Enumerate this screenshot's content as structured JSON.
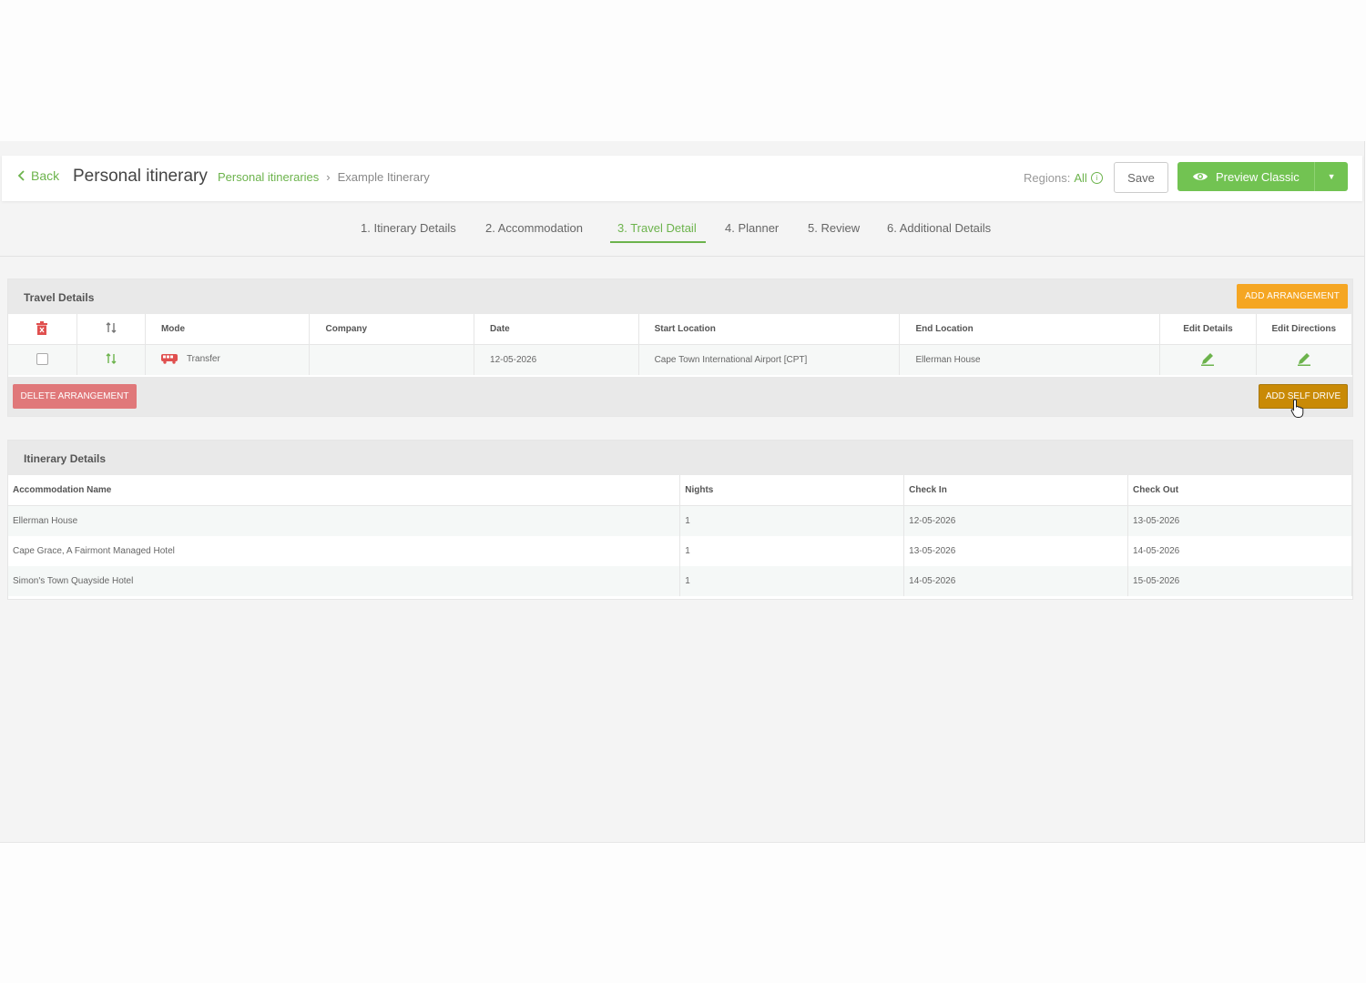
{
  "header": {
    "back_label": "Back",
    "title": "Personal itinerary",
    "breadcrumb": [
      {
        "label": "Personal itineraries"
      },
      {
        "label": "Example Itinerary"
      }
    ],
    "regions_label": "Regions:",
    "regions_value": "All",
    "save_label": "Save",
    "preview_label": "Preview Classic"
  },
  "tabs": [
    {
      "label": "1. Itinerary Details"
    },
    {
      "label": "2. Accommodation"
    },
    {
      "label": "3. Travel Detail",
      "active": true
    },
    {
      "label": "4. Planner"
    },
    {
      "label": "5. Review"
    },
    {
      "label": "6. Additional Details"
    }
  ],
  "travel": {
    "title": "Travel Details",
    "add_arrangement_label": "ADD ARRANGEMENT",
    "delete_arrangement_label": "DELETE ARRANGEMENT",
    "add_self_drive_label": "ADD SELF DRIVE",
    "columns": {
      "mode": "Mode",
      "company": "Company",
      "date": "Date",
      "start": "Start Location",
      "end": "End Location",
      "edit_details": "Edit Details",
      "edit_directions": "Edit Directions"
    },
    "rows": [
      {
        "mode": "Transfer",
        "company": "",
        "date": "12-05-2026",
        "start": "Cape Town International Airport [CPT]",
        "end": "Ellerman House"
      }
    ]
  },
  "itinerary": {
    "title": "Itinerary Details",
    "columns": {
      "name": "Accommodation Name",
      "nights": "Nights",
      "check_in": "Check In",
      "check_out": "Check Out"
    },
    "rows": [
      {
        "name": "Ellerman House",
        "nights": "1",
        "check_in": "12-05-2026",
        "check_out": "13-05-2026"
      },
      {
        "name": "Cape Grace, A Fairmont Managed Hotel",
        "nights": "1",
        "check_in": "13-05-2026",
        "check_out": "14-05-2026"
      },
      {
        "name": "Simon's Town Quayside Hotel",
        "nights": "1",
        "check_in": "14-05-2026",
        "check_out": "15-05-2026"
      }
    ]
  },
  "colors": {
    "accent_green": "#6cb34c",
    "button_orange": "#f5a623",
    "button_red": "#e0787a"
  }
}
